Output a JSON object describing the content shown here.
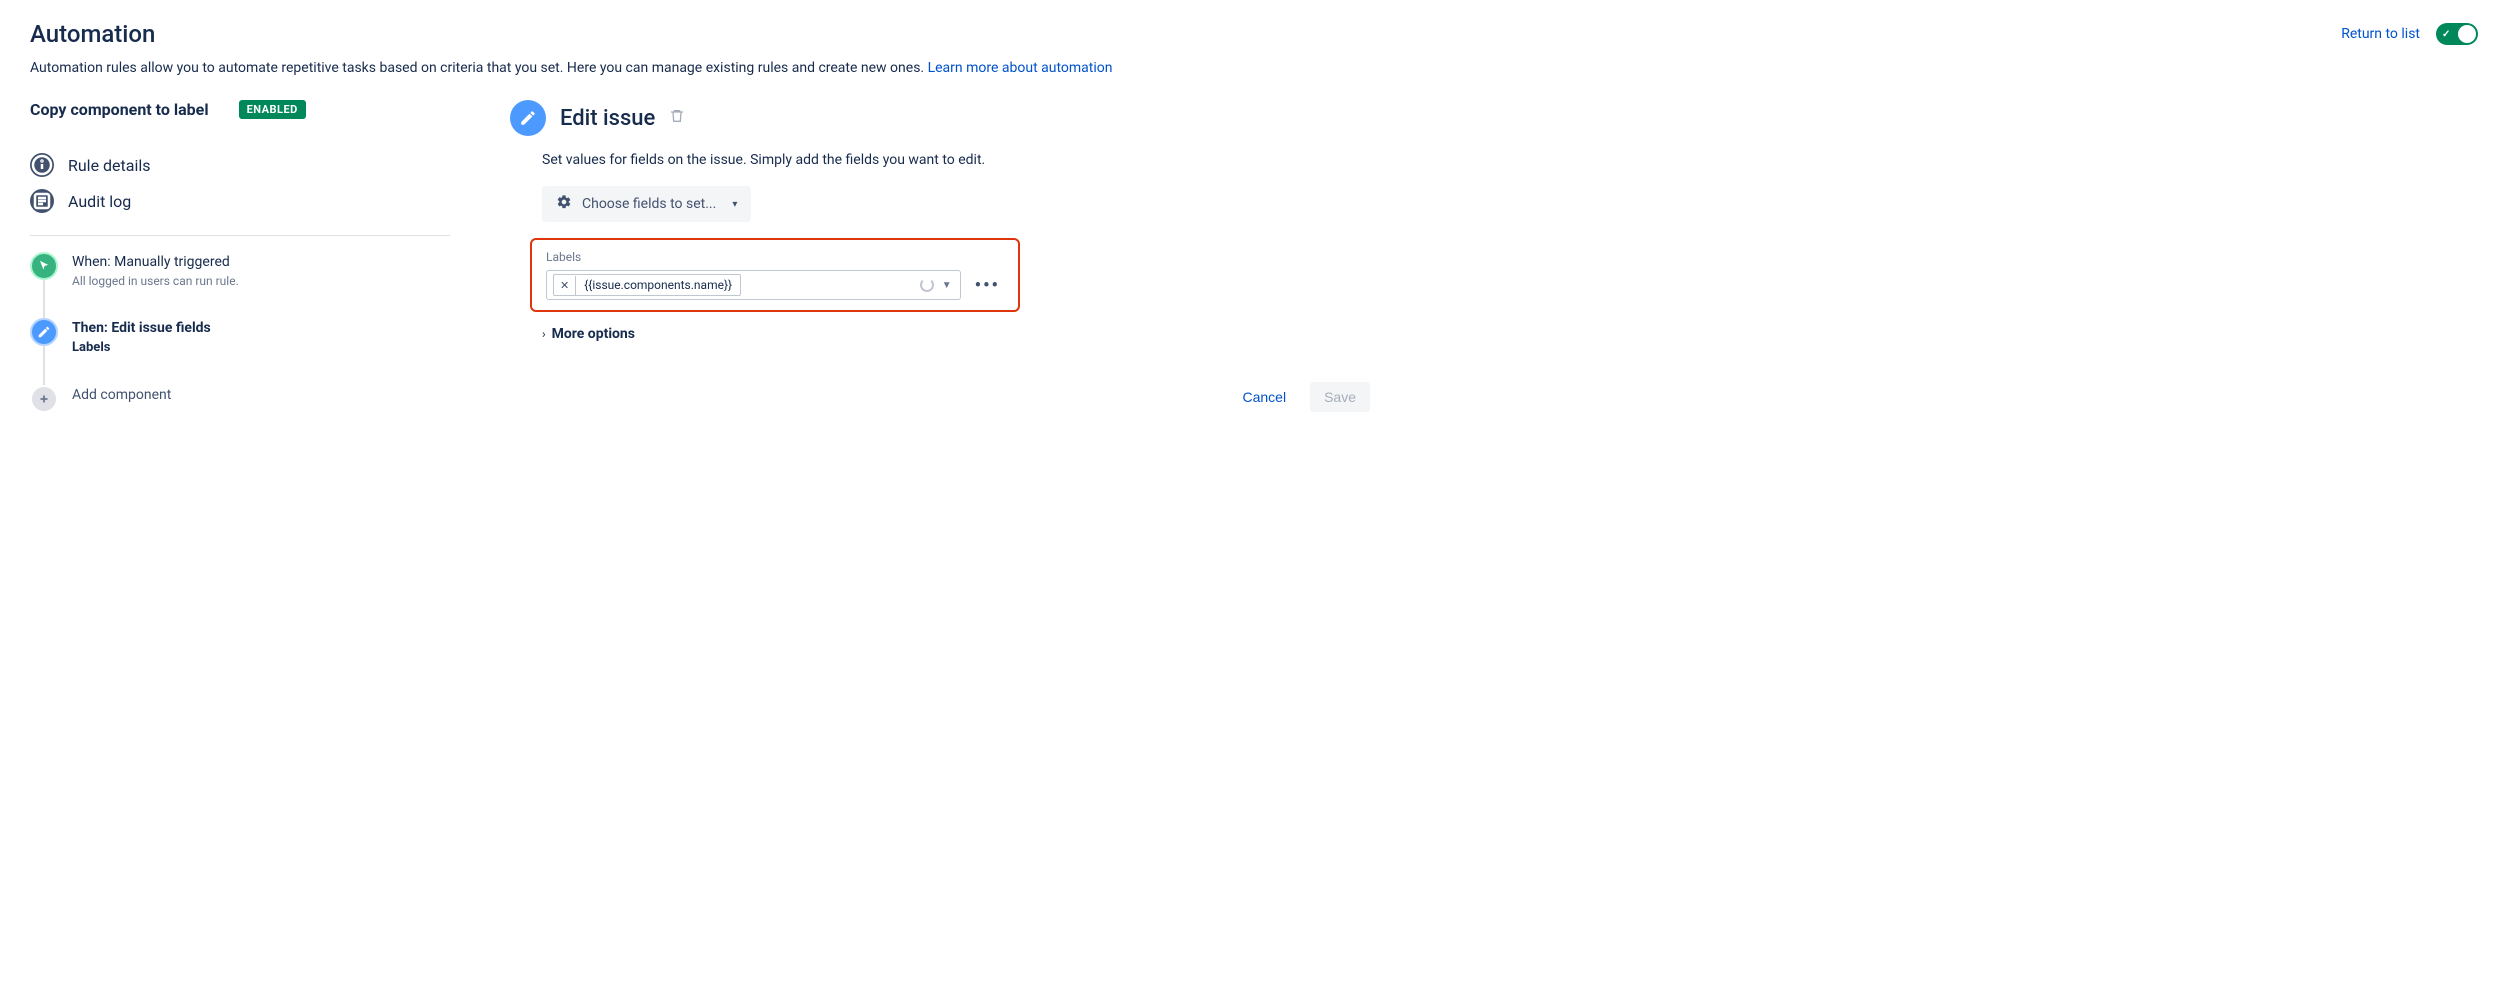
{
  "header": {
    "title": "Automation",
    "return_link": "Return to list",
    "toggle_on": true
  },
  "description": {
    "text": "Automation rules allow you to automate repetitive tasks based on criteria that you set. Here you can manage existing rules and create new ones. ",
    "link": "Learn more about automation"
  },
  "rule": {
    "name": "Copy component to label",
    "status": "ENABLED"
  },
  "nav": {
    "details": "Rule details",
    "audit": "Audit log"
  },
  "flow": {
    "when": {
      "title": "When: Manually triggered",
      "sub": "All logged in users can run rule."
    },
    "then": {
      "title": "Then: Edit issue fields",
      "sub": "Labels"
    },
    "add": {
      "title": "Add component"
    }
  },
  "editor": {
    "title": "Edit issue",
    "desc": "Set values for fields on the issue. Simply add the fields you want to edit.",
    "choose_label": "Choose fields to set...",
    "field_label": "Labels",
    "token_value": "{{issue.components.name}}",
    "more_options": "More options"
  },
  "buttons": {
    "cancel": "Cancel",
    "save": "Save"
  }
}
